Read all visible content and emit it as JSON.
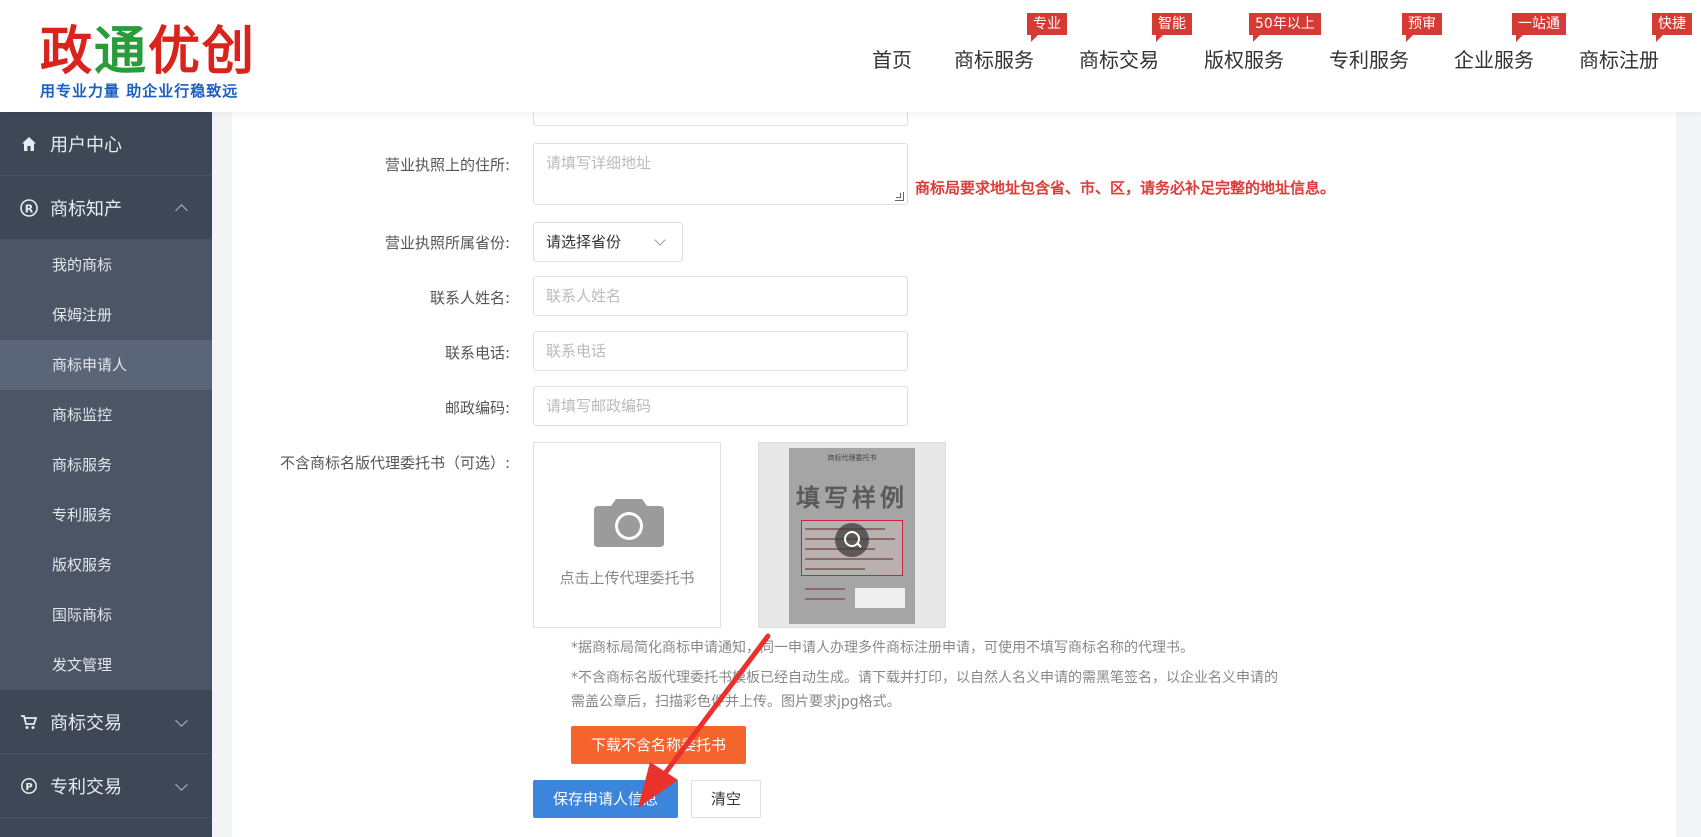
{
  "header": {
    "logo_main_red": "政",
    "logo_main_green": "通",
    "logo_main_red2": "优创",
    "logo_sub": "用专业力量 助企业行稳致远",
    "nav": [
      {
        "label": "首页",
        "badge": ""
      },
      {
        "label": "商标服务",
        "badge": "专业"
      },
      {
        "label": "商标交易",
        "badge": "智能"
      },
      {
        "label": "版权服务",
        "badge": "50年以上"
      },
      {
        "label": "专利服务",
        "badge": "预审"
      },
      {
        "label": "企业服务",
        "badge": "一站通"
      },
      {
        "label": "商标注册",
        "badge": "快捷"
      }
    ]
  },
  "sidebar": {
    "user_center": "用户中心",
    "trademark_ip": "商标知产",
    "sub_items": [
      "我的商标",
      "保姆注册",
      "商标申请人",
      "商标监控",
      "商标服务",
      "专利服务",
      "版权服务",
      "国际商标",
      "发文管理"
    ],
    "trademark_trade": "商标交易",
    "patent_trade": "专利交易"
  },
  "form": {
    "address_label": "营业执照上的住所:",
    "address_placeholder": "请填写详细地址",
    "address_warning": "商标局要求地址包含省、市、区，请务必补足完整的地址信息。",
    "province_label": "营业执照所属省份:",
    "province_value": "请选择省份",
    "contact_label": "联系人姓名:",
    "contact_placeholder": "联系人姓名",
    "phone_label": "联系电话:",
    "phone_placeholder": "联系电话",
    "postal_label": "邮政编码:",
    "postal_placeholder": "请填写邮政编码",
    "proxy_label": "不含商标名版代理委托书（可选）:",
    "upload_text": "点击上传代理委托书",
    "sample_stamp": "填写样例",
    "sample_title": "商标代理委托书",
    "note1": "*据商标局简化商标申请通知，同一申请人办理多件商标注册申请，可使用不填写商标名称的代理书。",
    "note2": "*不含商标名版代理委托书模板已经自动生成。请下载并打印，以自然人名义申请的需黑笔签名，以企业名义申请的需盖公章后，扫描彩色件并上传。图片要求jpg格式。",
    "download_button": "下载不含名称委托书",
    "save_button": "保存申请人信息",
    "clear_button": "清空"
  },
  "colors": {
    "brand_red": "#d9241d",
    "brand_green": "#2c9b3b",
    "sidebar_bg": "#3e4756",
    "primary_blue": "#3b86dc",
    "warning_red": "#e03b3b",
    "download_orange": "#f4642c",
    "arrow_red": "#e8322b"
  }
}
